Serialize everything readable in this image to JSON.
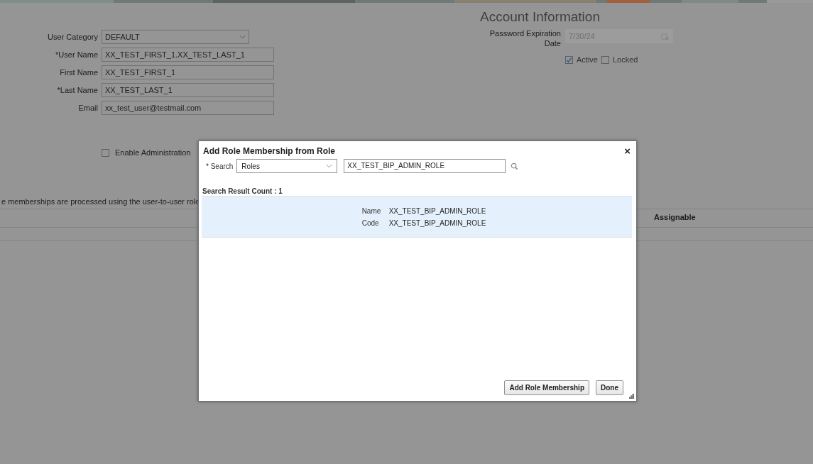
{
  "user_form": {
    "fields": [
      {
        "label": "User Category",
        "kind": "select",
        "value": "DEFAULT"
      },
      {
        "label": "*User Name",
        "kind": "text",
        "value": "XX_TEST_FIRST_1.XX_TEST_LAST_1"
      },
      {
        "label": "First Name",
        "kind": "text",
        "value": "XX_TEST_FIRST_1"
      },
      {
        "label": "*Last Name",
        "kind": "text",
        "value": "XX_TEST_LAST_1"
      },
      {
        "label": "Email",
        "kind": "text",
        "value": "xx_test_user@testmail.com"
      }
    ],
    "admin_checkbox": {
      "label": "Enable Administration",
      "checked": false
    }
  },
  "account_information": {
    "title": "Account Information",
    "password_expiration": {
      "label": "Password Expiration Date",
      "value": "7/30/24"
    },
    "checkboxes": [
      {
        "label": "Active",
        "checked": true
      },
      {
        "label": "Locked",
        "checked": false
      }
    ]
  },
  "role_note": "e memberships are processed using the user-to-user role",
  "table": {
    "columns": [
      "Assignable"
    ]
  },
  "dialog": {
    "title": "Add Role Membership from Role",
    "close": "×",
    "search": {
      "label": "* Search",
      "type": "Roles",
      "value": "XX_TEST_BIP_ADMIN_ROLE"
    },
    "result_count": "Search Result Count : 1",
    "results": [
      {
        "selected": true,
        "fields": [
          {
            "label": "Name",
            "value": "XX_TEST_BIP_ADMIN_ROLE"
          },
          {
            "label": "Code",
            "value": "XX_TEST_BIP_ADMIN_ROLE"
          }
        ]
      }
    ],
    "buttons": [
      "Add Role Membership",
      "Done"
    ]
  }
}
